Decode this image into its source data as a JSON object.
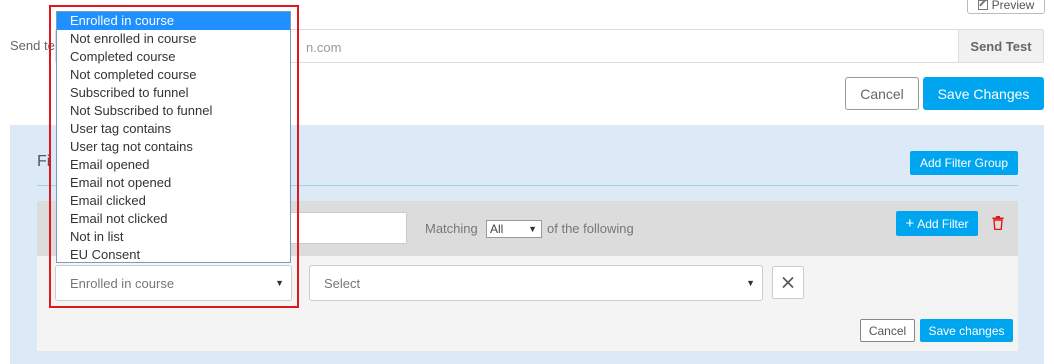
{
  "top": {
    "preview_label": "Preview",
    "send_label": "Send te",
    "send_input_partial": "n.com",
    "send_test_label": "Send Test",
    "cancel_label": "Cancel",
    "save_label": "Save Changes"
  },
  "filters": {
    "title": "Fi",
    "add_group_label": "Add Filter Group",
    "matching_label": "Matching",
    "matching_value": "All",
    "following_label": "of the following",
    "add_filter_label": "Add Filter",
    "filter_type_value": "Enrolled in course",
    "value_placeholder": "Select",
    "cancel_label": "Cancel",
    "save_label": "Save changes"
  },
  "dropdown": {
    "options": [
      "Enrolled in course",
      "Not enrolled in course",
      "Completed course",
      "Not completed course",
      "Subscribed to funnel",
      "Not Subscribed to funnel",
      "User tag contains",
      "User tag not contains",
      "Email opened",
      "Email not opened",
      "Email clicked",
      "Email not clicked",
      "Not in list",
      "EU Consent"
    ],
    "selected_index": 0
  },
  "colors": {
    "accent": "#00a5f0",
    "panel_bg": "#dbeaf6",
    "highlight": "#e0181e",
    "trash": "#e0181e"
  }
}
